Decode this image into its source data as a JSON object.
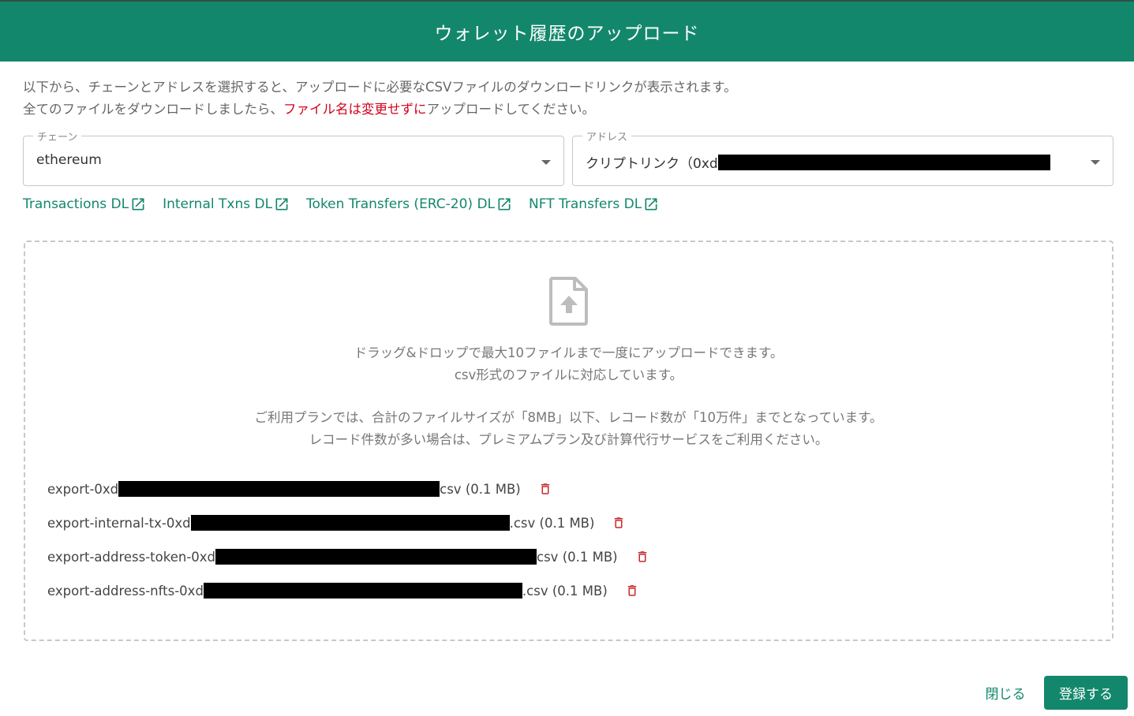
{
  "dialog": {
    "title": "ウォレット履歴のアップロード"
  },
  "intro": {
    "line1": "以下から、チェーンとアドレスを選択すると、アップロードに必要なCSVファイルのダウンロードリンクが表示されます。",
    "line2_prefix": "全てのファイルをダウンロードしましたら、",
    "line2_warning": "ファイル名は変更せずに",
    "line2_suffix": "アップロードしてください。"
  },
  "chain_field": {
    "label": "チェーン",
    "value": "ethereum"
  },
  "address_field": {
    "label": "アドレス",
    "value_prefix": "クリプトリンク（0xd"
  },
  "download_links": [
    {
      "label": "Transactions DL",
      "icon": "external-link-icon"
    },
    {
      "label": "Internal Txns DL",
      "icon": "external-link-icon"
    },
    {
      "label": "Token Transfers (ERC-20) DL",
      "icon": "external-link-icon"
    },
    {
      "label": "NFT Transfers DL",
      "icon": "external-link-icon"
    }
  ],
  "dropzone": {
    "icon": "file-upload-icon",
    "line1": "ドラッグ&ドロップで最大10ファイルまで一度にアップロードできます。",
    "line2": "csv形式のファイルに対応しています。",
    "line3": "ご利用プランでは、合計のファイルサイズが「8MB」以下、レコード数が「10万件」までとなっています。",
    "line4": "レコード件数が多い場合は、プレミアムプラン及び計算代行サービスをご利用ください。"
  },
  "files": [
    {
      "prefix": "export-0xd",
      "suffix": "csv (0.1 MB)"
    },
    {
      "prefix": "export-internal-tx-0xd",
      "suffix": ".csv (0.1 MB)"
    },
    {
      "prefix": "export-address-token-0xd",
      "suffix": "csv (0.1 MB)"
    },
    {
      "prefix": "export-address-nfts-0xd",
      "suffix": ".csv (0.1 MB)"
    }
  ],
  "footer": {
    "close_label": "閉じる",
    "submit_label": "登録する"
  },
  "colors": {
    "primary": "#13876c",
    "warning": "#d0021b",
    "delete": "#c62828"
  }
}
